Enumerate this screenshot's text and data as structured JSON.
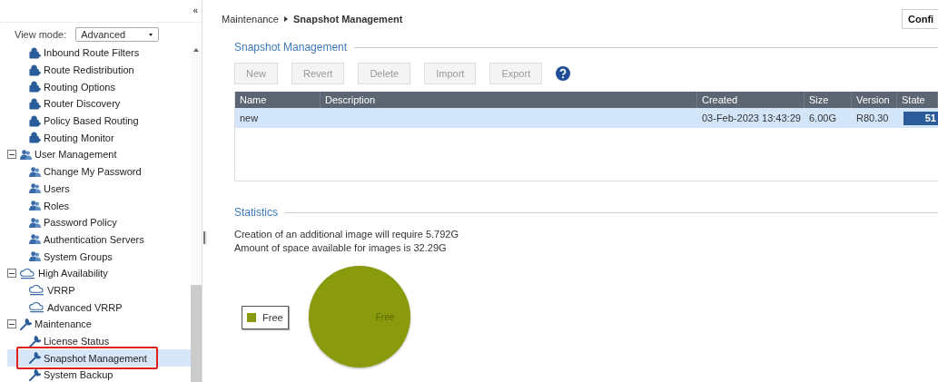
{
  "sidebar": {
    "collapse_icon": "«",
    "view_mode_label": "View mode:",
    "view_mode": "Advanced",
    "tree": [
      {
        "children": [
          {
            "label": "Inbound Route Filters",
            "kind": "route",
            "selected": false
          },
          {
            "label": "Route Redistribution",
            "kind": "route",
            "selected": false
          },
          {
            "label": "Routing Options",
            "kind": "route",
            "selected": false
          },
          {
            "label": "Router Discovery",
            "kind": "route",
            "selected": false
          },
          {
            "label": "Policy Based Routing",
            "kind": "route",
            "selected": false
          },
          {
            "label": "Routing Monitor",
            "kind": "route",
            "selected": false
          }
        ]
      },
      {
        "label": "User Management",
        "kind": "users",
        "expanded": true,
        "selected": false,
        "children": [
          {
            "label": "Change My Password",
            "kind": "users",
            "selected": false
          },
          {
            "label": "Users",
            "kind": "users",
            "selected": false
          },
          {
            "label": "Roles",
            "kind": "users",
            "selected": false
          },
          {
            "label": "Password Policy",
            "kind": "users",
            "selected": false
          },
          {
            "label": "Authentication Servers",
            "kind": "users",
            "selected": false
          },
          {
            "label": "System Groups",
            "kind": "users",
            "selected": false
          }
        ]
      },
      {
        "label": "High Availability",
        "kind": "cloud",
        "expanded": true,
        "selected": false,
        "children": [
          {
            "label": "VRRP",
            "kind": "cloud",
            "selected": false
          },
          {
            "label": "Advanced VRRP",
            "kind": "cloud",
            "selected": false
          }
        ]
      },
      {
        "label": "Maintenance",
        "kind": "wrench",
        "expanded": true,
        "selected": false,
        "children": [
          {
            "label": "License Status",
            "kind": "wrench",
            "selected": false
          },
          {
            "label": "Snapshot Management",
            "kind": "wrench",
            "selected": true,
            "highlighted": true
          },
          {
            "label": "System Backup",
            "kind": "wrench",
            "selected": false
          }
        ]
      }
    ]
  },
  "breadcrumb": {
    "parent": "Maintenance",
    "current": "Snapshot Management"
  },
  "top_button": "Confi",
  "snapshot_section": {
    "title": "Snapshot Management",
    "buttons": [
      {
        "label": "New",
        "disabled": true
      },
      {
        "label": "Revert",
        "disabled": true
      },
      {
        "label": "Delete",
        "disabled": true
      },
      {
        "label": "Import",
        "disabled": true
      },
      {
        "label": "Export",
        "disabled": true
      }
    ],
    "table": {
      "columns": [
        "Name",
        "Description",
        "Created",
        "Size",
        "Version",
        "State"
      ],
      "rows": [
        {
          "selected": true,
          "cells": [
            "new",
            "",
            "03-Feb-2023 13:43:29",
            "6.00G",
            "R80.30",
            "51"
          ]
        }
      ]
    }
  },
  "statistics": {
    "title": "Statistics",
    "lines": [
      "Creation of an additional image will require 5.792G",
      "Amount of space available for images is 32.29G"
    ],
    "pie_chart": {
      "legend_label": "Free",
      "slice_label": "Free",
      "color": "#8a9a10"
    }
  }
}
